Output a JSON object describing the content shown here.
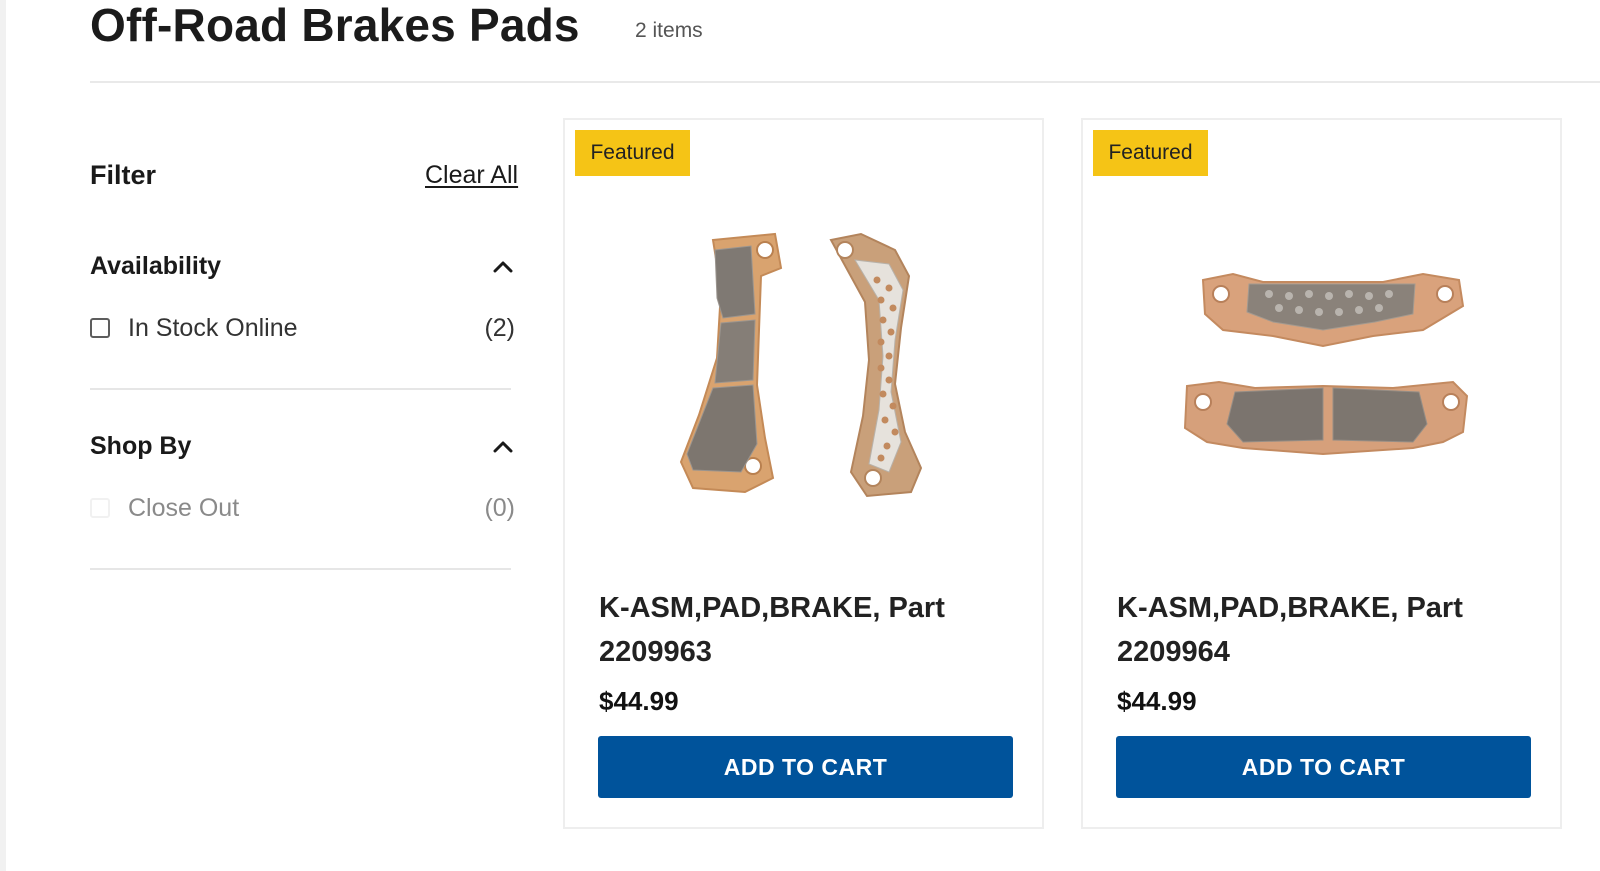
{
  "header": {
    "title": "Off-Road Brakes Pads",
    "item_count": "2 items"
  },
  "sidebar": {
    "filter_title": "Filter",
    "clear_all": "Clear All",
    "sections": [
      {
        "title": "Availability",
        "expanded": true,
        "options": [
          {
            "label": "In Stock Online",
            "count": "(2)",
            "checked": false,
            "disabled": false
          }
        ]
      },
      {
        "title": "Shop By",
        "expanded": true,
        "options": [
          {
            "label": "Close Out",
            "count": "(0)",
            "checked": false,
            "disabled": true
          }
        ]
      }
    ]
  },
  "products": [
    {
      "badge": "Featured",
      "name": "K-ASM,PAD,BRAKE, Part 2209963",
      "price": "$44.99",
      "cta": "ADD TO CART",
      "image": "brake-pads-pair-vertical"
    },
    {
      "badge": "Featured",
      "name": "K-ASM,PAD,BRAKE, Part 2209964",
      "price": "$44.99",
      "cta": "ADD TO CART",
      "image": "brake-pads-pair-horizontal"
    }
  ],
  "colors": {
    "accent_button": "#00539b",
    "badge": "#f5c416",
    "pad_copper": "#d79a6f",
    "pad_friction": "#7c736c"
  },
  "icons": {
    "section_toggle": "chevron-up-icon",
    "checkbox": "checkbox-icon"
  }
}
